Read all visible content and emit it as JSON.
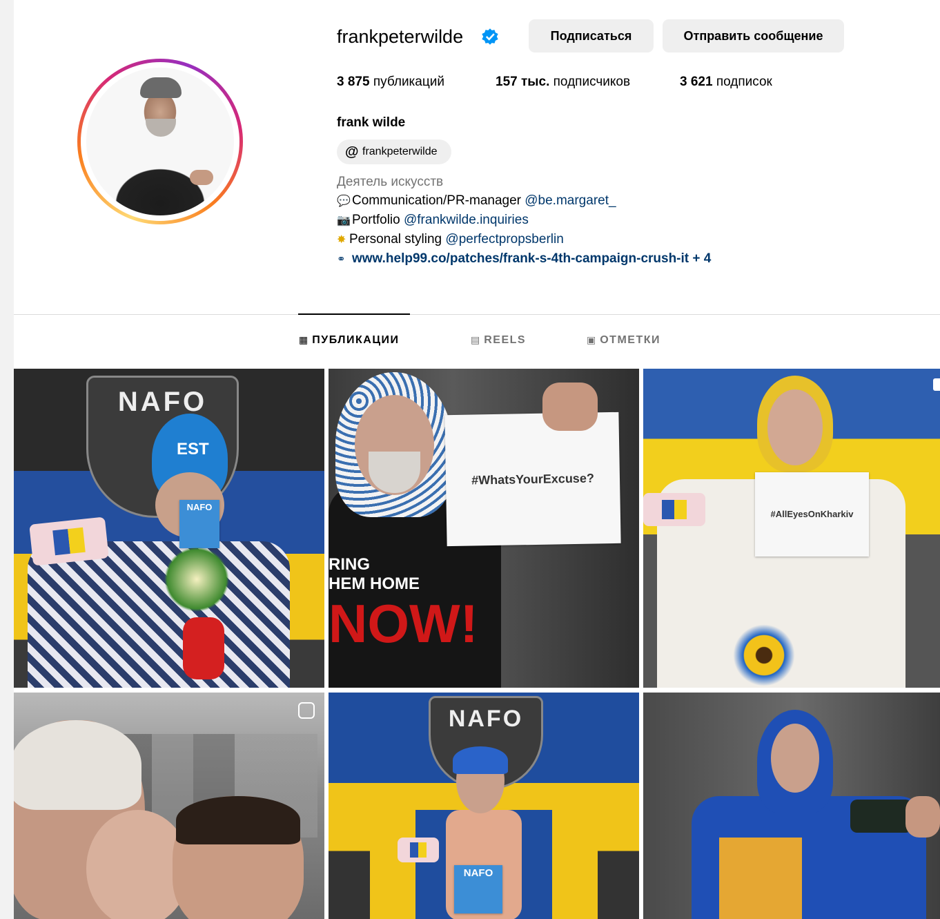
{
  "profile": {
    "username": "frankpeterwilde",
    "follow_label": "Подписаться",
    "message_label": "Отправить сообщение",
    "stats": {
      "posts_count": "3 875",
      "posts_label": "публикаций",
      "followers_count": "157 тыс.",
      "followers_label": "подписчиков",
      "following_count": "3 621",
      "following_label": "подписок"
    },
    "full_name": "frank wilde",
    "threads_handle": "frankpeterwilde",
    "category": "Деятель искусств",
    "bio": [
      {
        "icon": "speech-bubble-icon",
        "text": "Communication/PR-manager ",
        "mention": "@be.margaret_"
      },
      {
        "icon": "camera-icon",
        "text": "Portfolio ",
        "mention": "@frankwilde.inquiries"
      },
      {
        "icon": "sparkle-icon",
        "text": "Personal styling ",
        "mention": "@perfectpropsberlin"
      }
    ],
    "link": "www.help99.co/patches/frank-s-4th-campaign-crush-it",
    "link_more": "+ 4"
  },
  "tabs": [
    {
      "label": "ПУБЛИКАЦИИ",
      "icon": "grid-icon",
      "active": true
    },
    {
      "label": "REELS",
      "icon": "reels-icon",
      "active": false
    },
    {
      "label": "ОТМЕТКИ",
      "icon": "tagged-icon",
      "active": false
    }
  ],
  "posts": [
    {
      "badge": "NAFO",
      "hat": "EST",
      "card": "NAFO"
    },
    {
      "sign": "#WhatsYourExcuse?",
      "shirt1": "RING",
      "shirt2": "HEM HOME",
      "shirt3": "NOW!"
    },
    {
      "sign": "#AllEyesOnKharkiv"
    },
    {},
    {
      "badge": "NAFO",
      "chest": "NAFO"
    },
    {}
  ],
  "colors": {
    "link": "#00376b",
    "verified": "#0095f6",
    "button_bg": "#efefef",
    "muted": "#737373"
  }
}
